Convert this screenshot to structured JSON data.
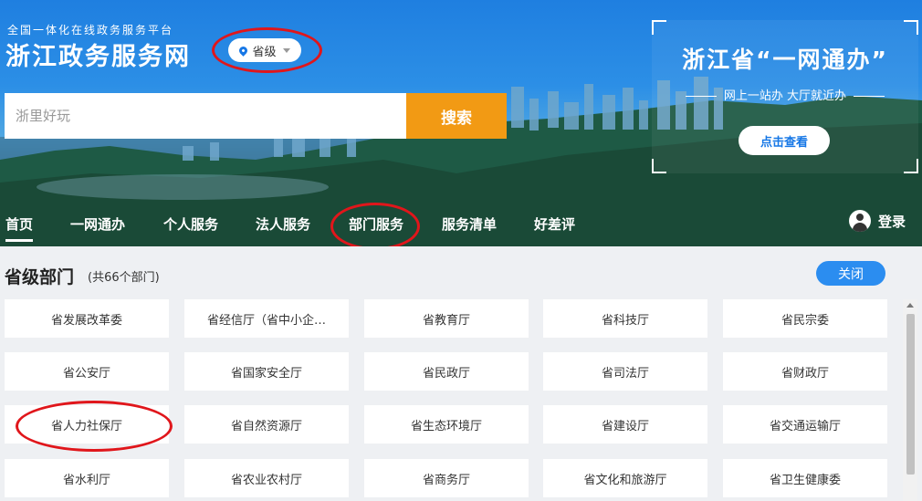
{
  "header": {
    "subtitle": "全国一体化在线政务服务平台",
    "title": "浙江政务服务网",
    "region": {
      "label": "省级",
      "icon": "location-pin-icon"
    }
  },
  "search": {
    "placeholder": "浙里好玩",
    "button": "搜索"
  },
  "promo": {
    "title": "浙江省“一网通办”",
    "subtitle": "网上一站办 大厅就近办",
    "button": "点击查看"
  },
  "nav": {
    "items": [
      {
        "label": "首页",
        "active": true
      },
      {
        "label": "一网通办"
      },
      {
        "label": "个人服务"
      },
      {
        "label": "法人服务"
      },
      {
        "label": "部门服务"
      },
      {
        "label": "服务清单"
      },
      {
        "label": "好差评"
      }
    ],
    "login": "登录"
  },
  "departments": {
    "title": "省级部门",
    "count": "(共66个部门)",
    "close": "关闭",
    "items": [
      "省发展改革委",
      "省经信厅（省中小企…",
      "省教育厅",
      "省科技厅",
      "省民宗委",
      "省公安厅",
      "省国家安全厅",
      "省民政厅",
      "省司法厅",
      "省财政厅",
      "省人力社保厅",
      "省自然资源厅",
      "省生态环境厅",
      "省建设厅",
      "省交通运输厅",
      "省水利厅",
      "省农业农村厅",
      "省商务厅",
      "省文化和旅游厅",
      "省卫生健康委"
    ]
  },
  "colors": {
    "accent": "#2b8df0",
    "search_button": "#f29a14",
    "annotation": "#e0161b"
  }
}
